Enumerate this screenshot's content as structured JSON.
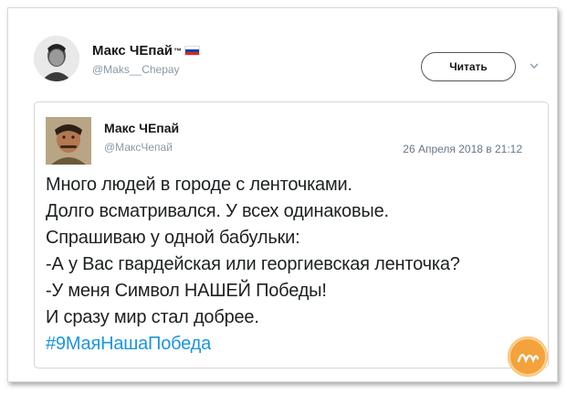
{
  "outer_tweet": {
    "name": "Макс ЧЕпай",
    "trademark": "™",
    "handle": "@Maks__Chepay",
    "follow_label": "Читать"
  },
  "quoted_tweet": {
    "name": "Макс ЧЕпай",
    "handle": "@МаксЧепай",
    "date": "26 Апреля 2018 в 21:12",
    "lines": [
      "Много людей в городе с ленточками.",
      "Долго всматривался. У всех одинаковые.",
      "Спрашиваю у одной бабульки:",
      "-А у Вас гвардейская или георгиевская ленточка?",
      "-У меня Символ НАШЕЙ Победы!",
      "И сразу мир стал добрее."
    ],
    "hashtag": "#9МаяНашаПобеда"
  },
  "icons": {
    "flag": "russia-flag-icon",
    "chevron": "chevron-down-icon",
    "watermark": "site-logo"
  },
  "colors": {
    "hashtag": "#1b95e0",
    "handle": "#8899a6",
    "watermark": "#f3a23c"
  }
}
